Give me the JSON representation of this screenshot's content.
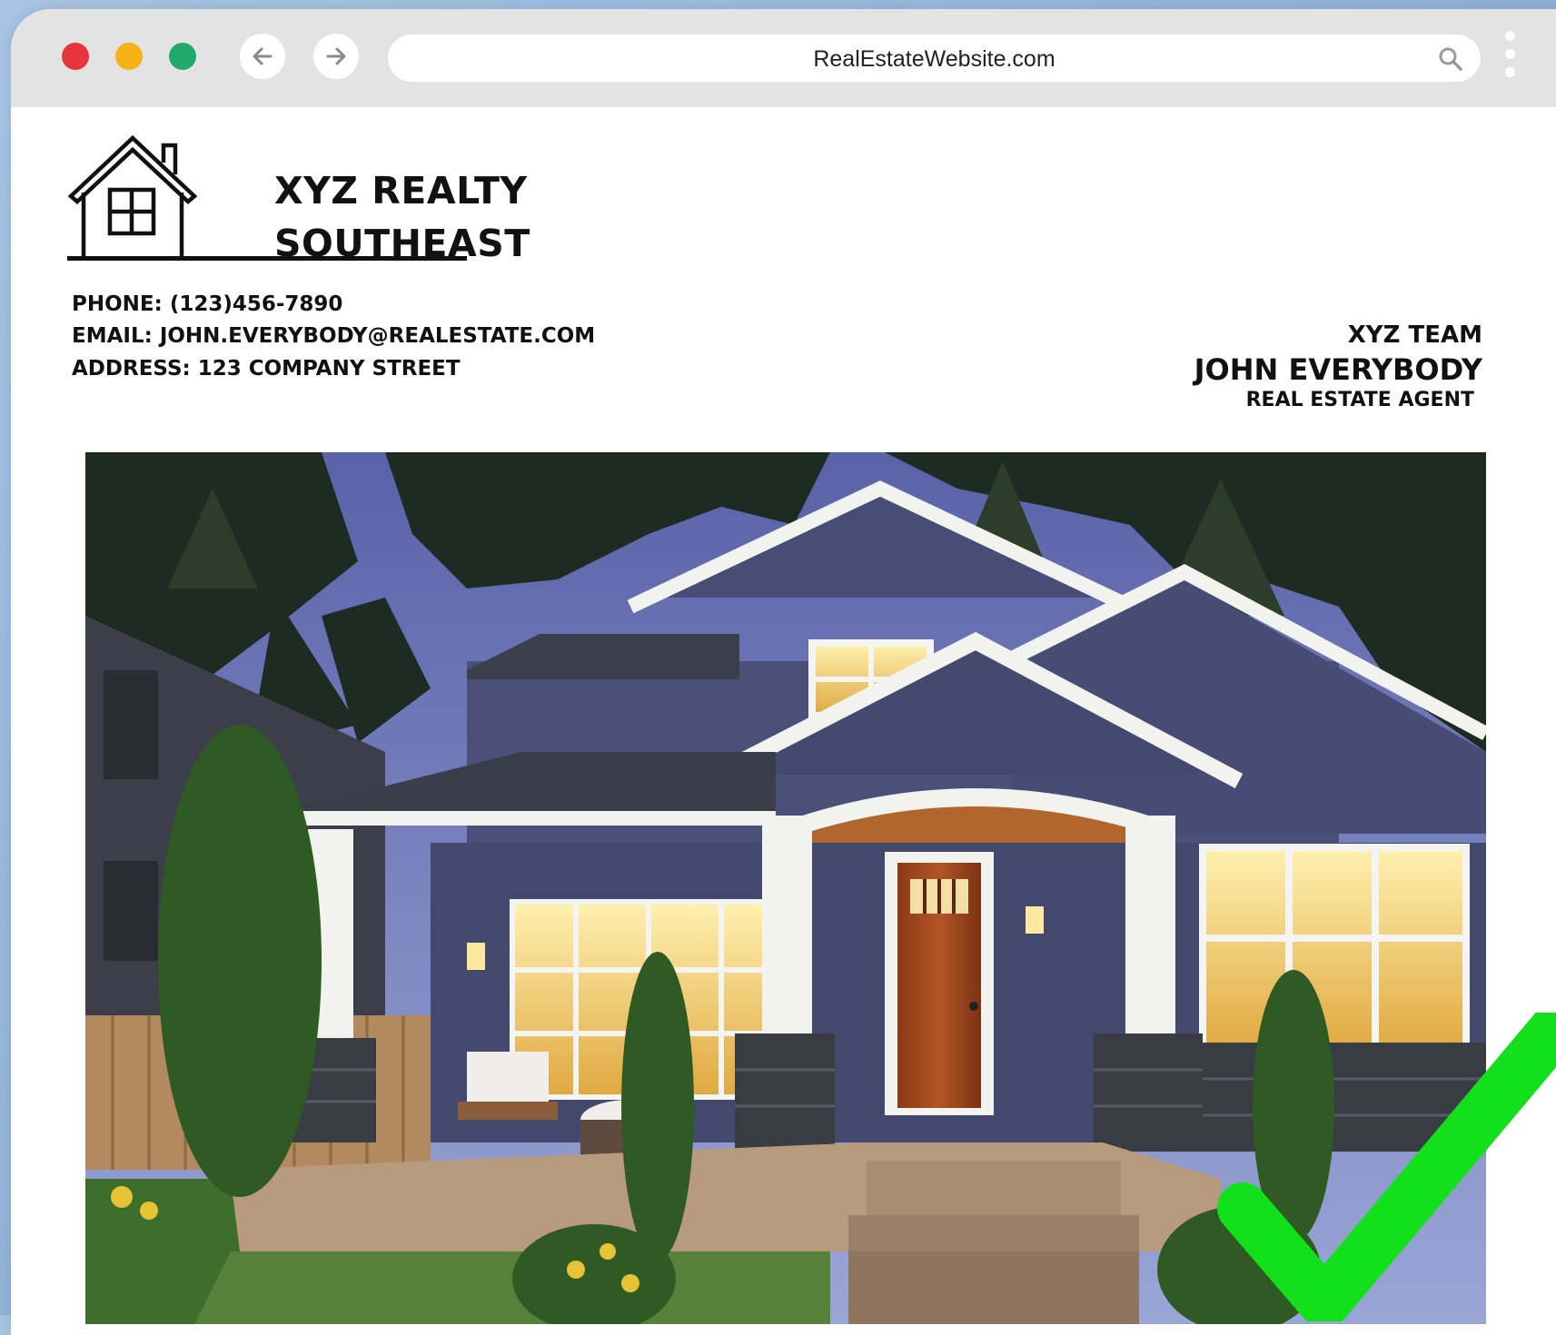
{
  "browser": {
    "url": "RealEstateWebsite.com",
    "traffic_lights": [
      "#e8343d",
      "#f4b213",
      "#1faa6b"
    ],
    "back_icon": "arrow-left-icon",
    "forward_icon": "arrow-right-icon",
    "search_icon": "magnifier-icon",
    "menu_icon": "vertical-dots-icon"
  },
  "header": {
    "company_line1": "XYZ REALTY",
    "company_line2": "SOUTHEAST",
    "phone": "PHONE: (123)456-7890",
    "email": "EMAIL: JOHN.EVERYBODY@REALESTATE.COM",
    "address": "ADDRESS: 123 COMPANY STREET",
    "logo_icon": "house-icon"
  },
  "agent": {
    "team": "XYZ TEAM",
    "name": "JOHN EVERYBODY",
    "title": "REAL ESTATE AGENT"
  },
  "photo": {
    "subject": "house-photo"
  },
  "overlay": {
    "icon": "green-checkmark-icon",
    "color": "#12e01a"
  }
}
